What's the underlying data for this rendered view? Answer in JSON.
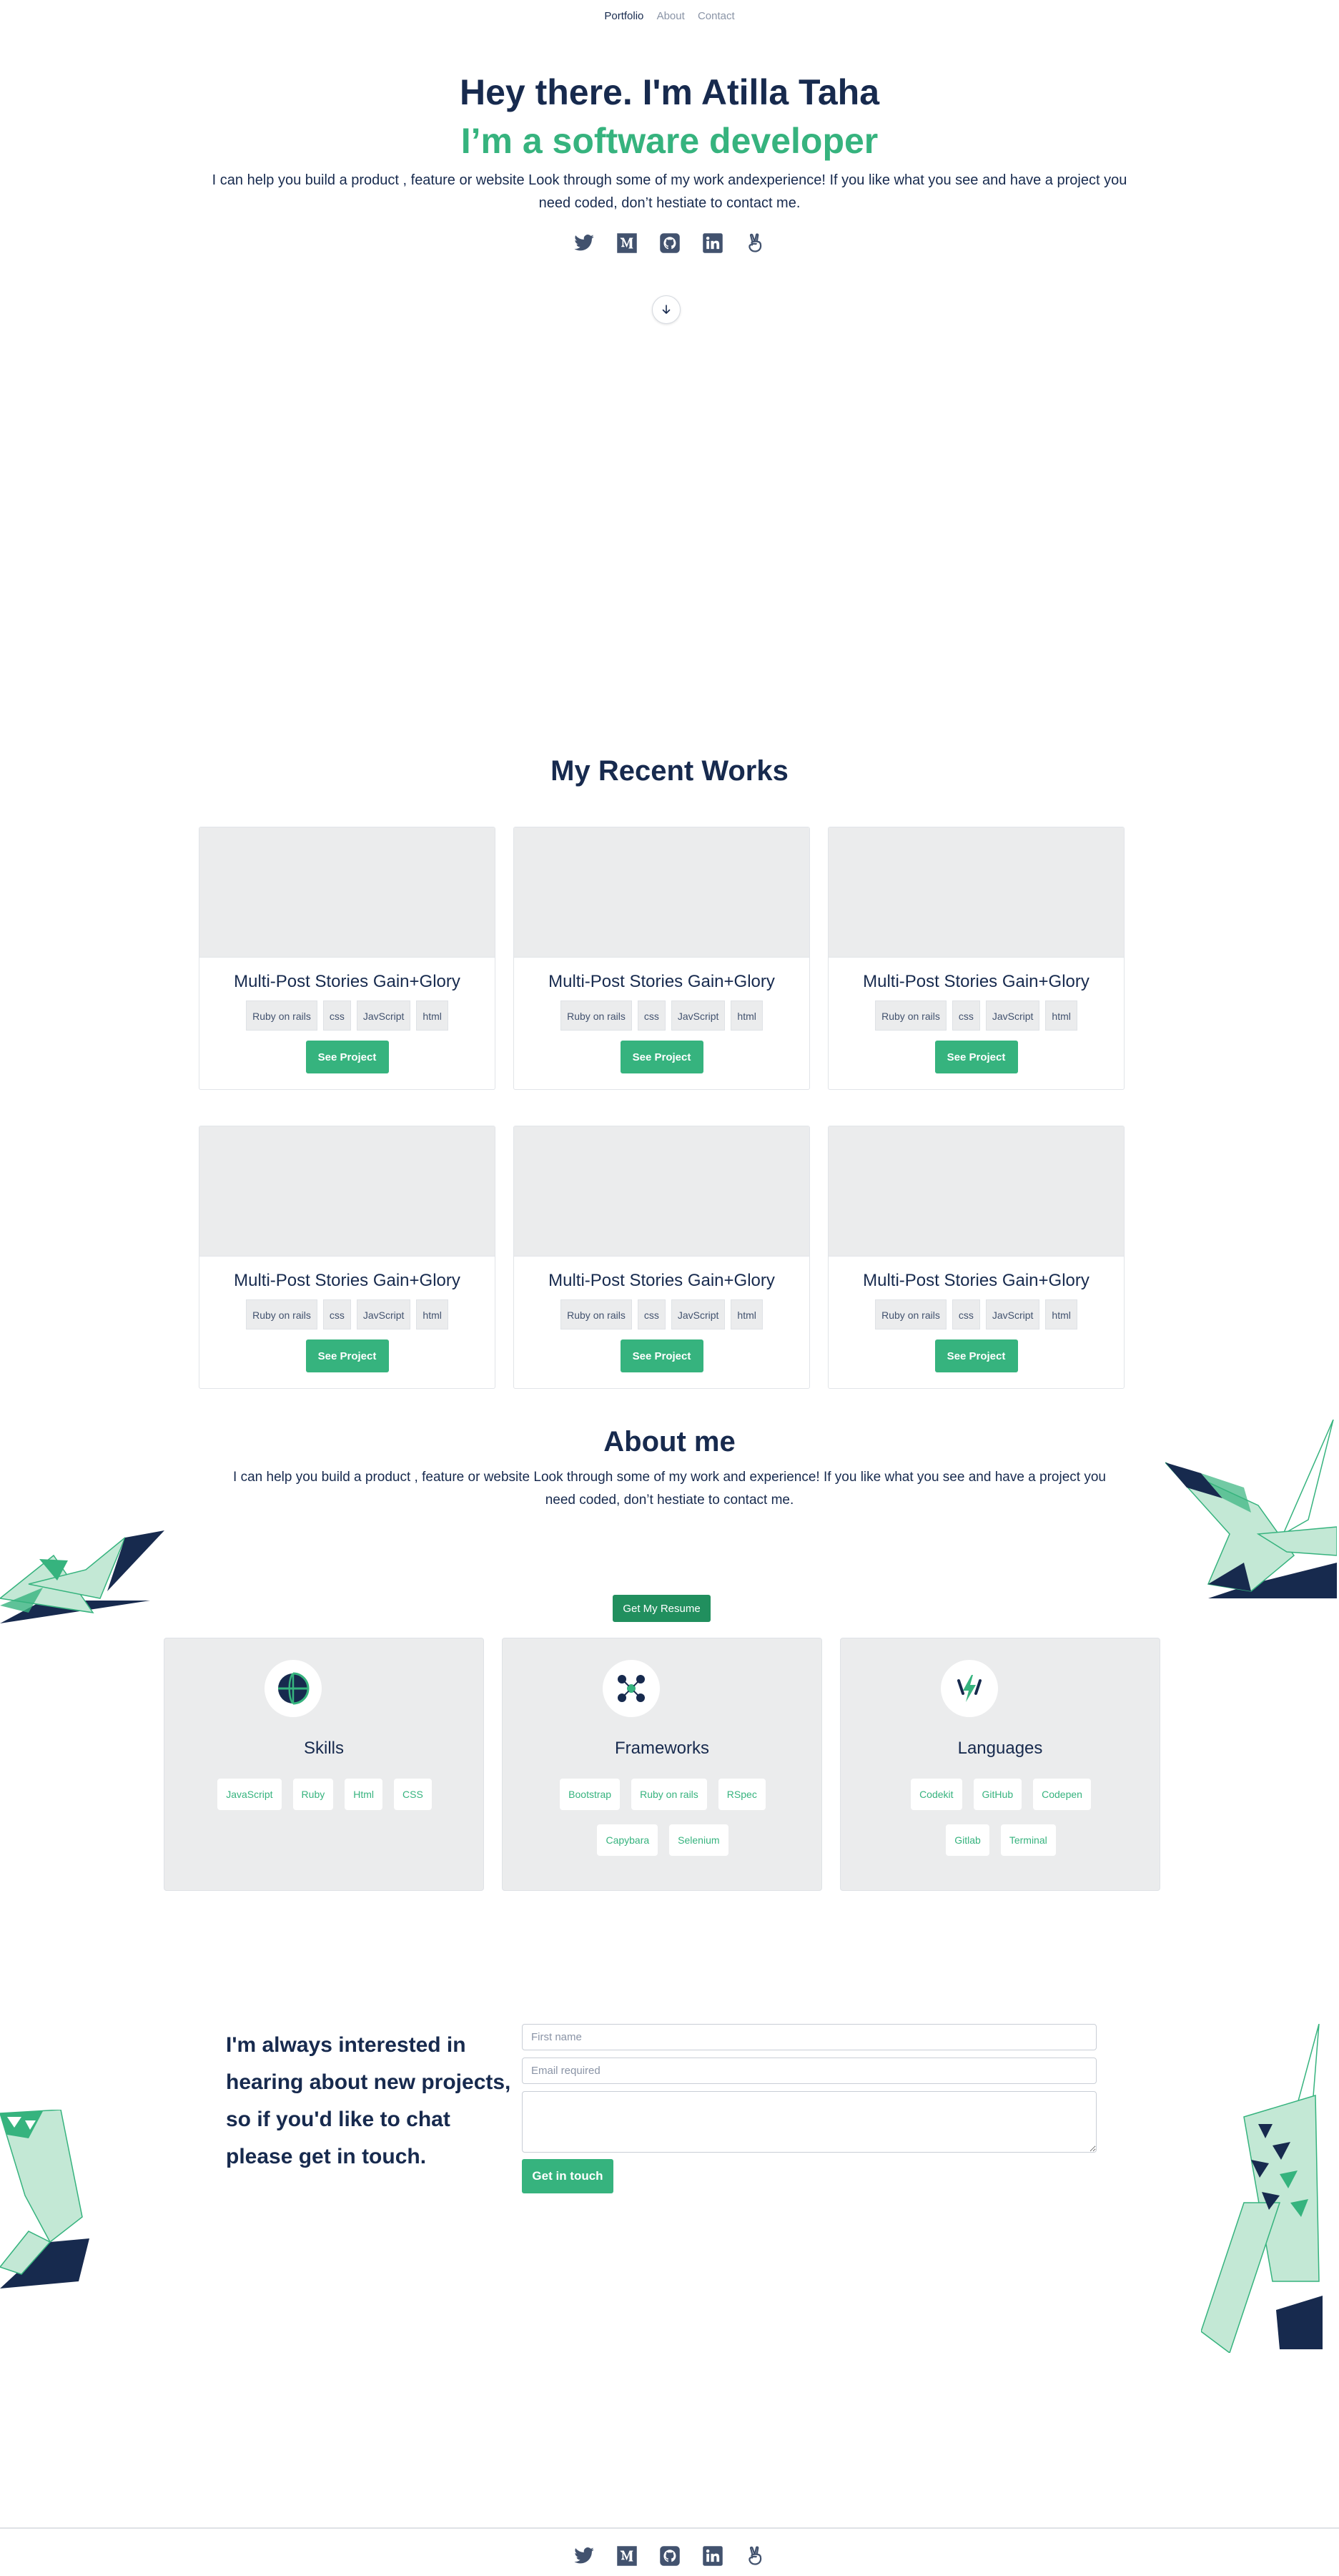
{
  "nav": {
    "items": [
      {
        "label": "Portfolio",
        "active": true
      },
      {
        "label": "About",
        "active": false
      },
      {
        "label": "Contact",
        "active": false
      }
    ]
  },
  "hero": {
    "title": "Hey there. I'm Atilla Taha",
    "subtitle": "I’m a software developer",
    "description": "I can help you build a product , feature or website Look through some of my work andexperience! If you like what you see and have a project you need coded, don’t hestiate to contact me."
  },
  "social": {
    "icons": [
      "twitter-icon",
      "medium-icon",
      "github-icon",
      "linkedin-icon",
      "angellist-icon"
    ]
  },
  "works": {
    "title": "My Recent Works",
    "projects": [
      {
        "title": "Multi-Post Stories Gain+Glory",
        "tags": [
          "Ruby on rails",
          "css",
          "JavScript",
          "html"
        ],
        "button": "See Project"
      },
      {
        "title": "Multi-Post Stories Gain+Glory",
        "tags": [
          "Ruby on rails",
          "css",
          "JavScript",
          "html"
        ],
        "button": "See Project"
      },
      {
        "title": "Multi-Post Stories Gain+Glory",
        "tags": [
          "Ruby on rails",
          "css",
          "JavScript",
          "html"
        ],
        "button": "See Project"
      },
      {
        "title": "Multi-Post Stories Gain+Glory",
        "tags": [
          "Ruby on rails",
          "css",
          "JavScript",
          "html"
        ],
        "button": "See Project"
      },
      {
        "title": "Multi-Post Stories Gain+Glory",
        "tags": [
          "Ruby on rails",
          "css",
          "JavScript",
          "html"
        ],
        "button": "See Project"
      },
      {
        "title": "Multi-Post Stories Gain+Glory",
        "tags": [
          "Ruby on rails",
          "css",
          "JavScript",
          "html"
        ],
        "button": "See Project"
      }
    ]
  },
  "about": {
    "title": "About me",
    "description": "I can help you build a product , feature or website Look through some of my work and experience! If you like what you see and have a project you need coded, don’t hestiate to contact me.",
    "resume_button": "Get My Resume",
    "cards": [
      {
        "name": "Skills",
        "icon": "globe-icon",
        "items": [
          "JavaScript",
          "Ruby",
          "Html",
          "CSS"
        ]
      },
      {
        "name": "Frameworks",
        "icon": "network-icon",
        "items": [
          "Bootstrap",
          "Ruby on rails",
          "RSpec",
          "Capybara",
          "Selenium"
        ]
      },
      {
        "name": "Languages",
        "icon": "lightning-icon",
        "items": [
          "Codekit",
          "GitHub",
          "Codepen",
          "Gitlab",
          "Terminal"
        ]
      }
    ]
  },
  "contact": {
    "text": "I'm always interested in hearing about new projects, so if you'd like to chat please get in touch.",
    "name_placeholder": "First name",
    "email_placeholder": "Email required",
    "message_placeholder": "",
    "button": "Get in touch"
  },
  "colors": {
    "accent": "#36b37e",
    "navy": "#172a4e",
    "card_bg": "#ebeced",
    "resume_button": "#218f5e"
  }
}
